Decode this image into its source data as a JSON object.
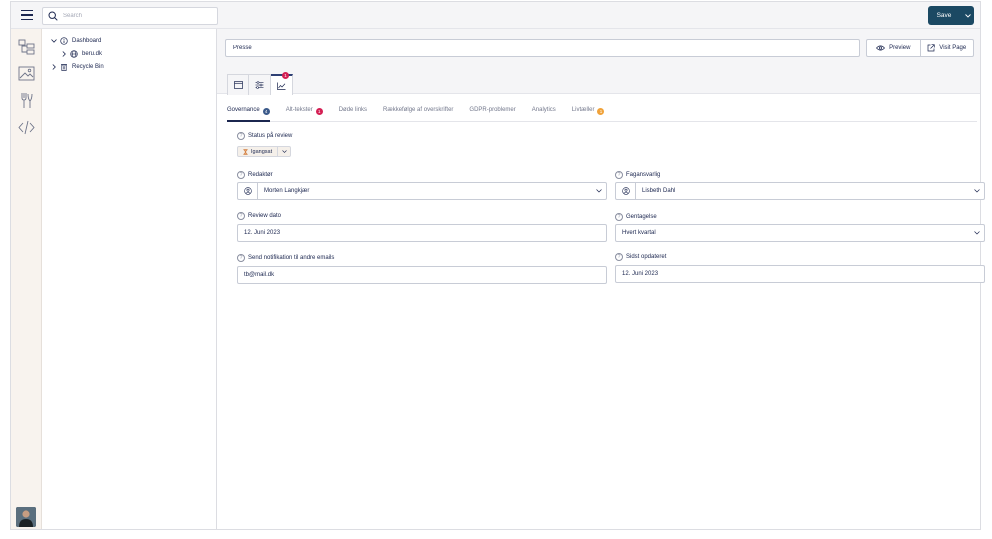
{
  "search": {
    "placeholder": "Search"
  },
  "toolbar": {
    "save_label": "Save"
  },
  "tree": {
    "items": [
      {
        "label": "Dashboard"
      },
      {
        "label": "beru.dk"
      },
      {
        "label": "Recycle Bin"
      }
    ]
  },
  "document": {
    "name": "Presse",
    "preview_label": "Preview",
    "visit_label": "Visit Page"
  },
  "app_tabs": {
    "badge": "1"
  },
  "sub_tabs": [
    {
      "label": "Governance",
      "count": "4"
    },
    {
      "label": "Alt-tekster",
      "count": "1"
    },
    {
      "label": "Døde links"
    },
    {
      "label": "Rækkefølge af overskrifter"
    },
    {
      "label": "GDPR-problemer"
    },
    {
      "label": "Analytics"
    },
    {
      "label": "Livtæller",
      "count": "1"
    }
  ],
  "fields": {
    "status_label": "Status på review",
    "status_value": "Igangsat",
    "redaktor_label": "Redaktør",
    "redaktor_value": "Morten Langkjær",
    "fagansvarlig_label": "Fagansvarlig",
    "fagansvarlig_value": "Lisbeth Dahl",
    "review_label": "Review dato",
    "review_value": "12. Juni 2023",
    "gentagelse_label": "Gentagelse",
    "gentagelse_value": "Hvert kvartal",
    "notify_label": "Send notifikation til andre emails",
    "notify_value": "tb@mail.dk",
    "sidst_label": "Sidst opdateret",
    "sidst_value": "12. Juni 2023"
  },
  "colors": {
    "brand": "#1b4963",
    "navy": "#1b264f",
    "badge_red": "#d42054",
    "badge_blue": "#3b5a8a",
    "badge_orange": "#f0a23a",
    "rail_bg": "#f8f3ee"
  },
  "icons": [
    "menu-icon",
    "search-icon",
    "chevron-down-icon",
    "content-tree-icon",
    "media-icon",
    "settings-tools-icon",
    "code-icon",
    "info-icon",
    "globe-icon",
    "trash-icon",
    "eye-icon",
    "external-link-icon",
    "document-icon",
    "sliders-icon",
    "chart-icon",
    "question-icon",
    "hourglass-icon",
    "people-icon"
  ]
}
